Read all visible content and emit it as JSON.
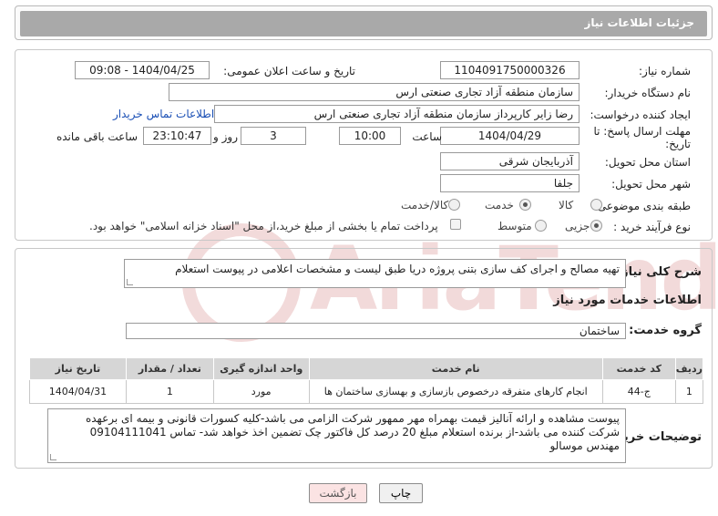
{
  "header": {
    "title": "جزئیات اطلاعات نیاز"
  },
  "form": {
    "need_number_label": "شماره نیاز:",
    "need_number": "1104091750000326",
    "announce_label": "تاریخ و ساعت اعلان عمومی:",
    "announce_value": "1404/04/25 - 09:08",
    "buyer_org_label": "نام دستگاه خریدار:",
    "buyer_org": "سازمان منطقه آزاد تجاری صنعتی ارس",
    "requester_label": "ایجاد کننده درخواست:",
    "requester": "رضا زایر کارپرداز سازمان منطقه آزاد تجاری صنعتی ارس",
    "contact_link": "اطلاعات تماس خریدار",
    "deadline_label_1": "مهلت ارسال پاسخ: تا",
    "deadline_label_2": "تاریخ:",
    "deadline_date": "1404/04/29",
    "time_label": "ساعت",
    "deadline_time": "10:00",
    "days_value": "3",
    "days_label": "روز و",
    "remaining_time": "23:10:47",
    "remaining_label": "ساعت باقی مانده",
    "province_label": "استان محل تحویل:",
    "province": "آذربایجان شرقی",
    "city_label": "شهر محل تحویل:",
    "city": "جلفا",
    "category_label": "طبقه بندی موضوعی:",
    "category_options": [
      "کالا",
      "خدمت",
      "کالا/خدمت"
    ],
    "category_selected": "خدمت",
    "process_label": "نوع فرآیند خرید :",
    "process_options": [
      "جزیی",
      "متوسط"
    ],
    "process_selected": "جزیی",
    "payment_note": "پرداخت تمام یا بخشی از مبلغ خرید،از محل \"اسناد خزانه اسلامی\" خواهد بود."
  },
  "description": {
    "label": "شرح کلی نیاز:",
    "text": "تهیه مصالح و اجرای کف سازی بتنی پروژه دریا طبق لیست و مشخصات اعلامی در پیوست استعلام"
  },
  "services": {
    "section_title": "اطلاعات خدمات مورد نیاز",
    "group_label": "گروه خدمت:",
    "group_value": "ساختمان",
    "columns": [
      "ردیف",
      "کد خدمت",
      "نام خدمت",
      "واحد اندازه گیری",
      "تعداد / مقدار",
      "تاریخ نیاز"
    ],
    "rows": [
      [
        "1",
        "ج-44",
        "انجام کارهای متفرقه درخصوص بازسازی و بهسازی ساختمان ها",
        "مورد",
        "1",
        "1404/04/31"
      ]
    ]
  },
  "buyer_notes": {
    "label": "توضیحات خریدار:",
    "text": "پیوست مشاهده و ارائه آنالیز قیمت بهمراه مهر ممهور شرکت الزامی می باشد-کلیه کسورات قانونی و بیمه ای برعهده شرکت کننده می باشد-از برنده استعلام مبلغ 20 درصد کل فاکتور چک تضمین اخذ خواهد شد- تماس  09104111041 مهندس موسالو"
  },
  "buttons": {
    "print": "چاپ",
    "back": "بازگشت"
  },
  "watermark": {
    "text": "AriaTender.neT"
  },
  "colors": {
    "header_bar": "#a9a9a9",
    "link": "#1a4fb5",
    "back_button": "#fbe3e3"
  }
}
